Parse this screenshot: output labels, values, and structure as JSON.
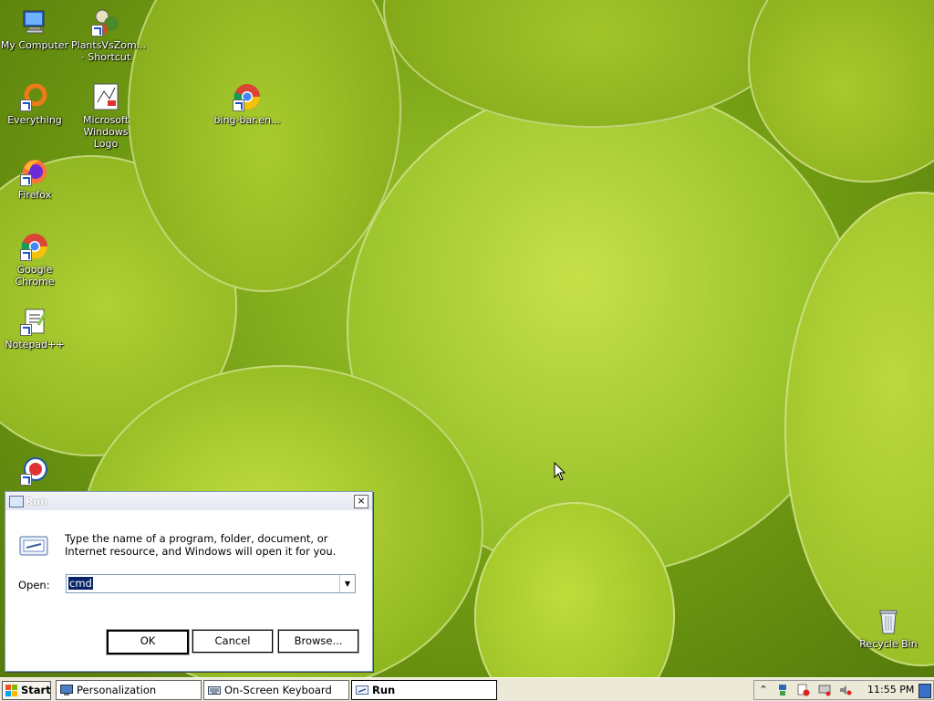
{
  "desktop": {
    "icons": [
      {
        "label": "My Computer"
      },
      {
        "label": "PlantsVsZom... - Shortcut"
      },
      {
        "label": "Everything"
      },
      {
        "label": "Microsoft Windows Logo"
      },
      {
        "label": "bing-bar.en..."
      },
      {
        "label": "Firefox"
      },
      {
        "label": "Google Chrome"
      },
      {
        "label": "Notepad++"
      },
      {
        "label": "Recycle Bin"
      }
    ]
  },
  "run_dialog": {
    "title": "Run",
    "close": "×",
    "description": "Type the name of a program, folder, document, or Internet resource, and Windows will open it for you.",
    "open_label": "Open:",
    "open_value": "cmd",
    "ok": "OK",
    "cancel": "Cancel",
    "browse": "Browse..."
  },
  "taskbar": {
    "start": "Start",
    "tasks": [
      {
        "label": "Personalization"
      },
      {
        "label": "On-Screen Keyboard"
      },
      {
        "label": "Run"
      }
    ],
    "clock": "11:55 PM"
  },
  "colors": {
    "wallpaper": "#7aa516",
    "selection": "#0a246a",
    "taskbar": "#ece9d8"
  }
}
